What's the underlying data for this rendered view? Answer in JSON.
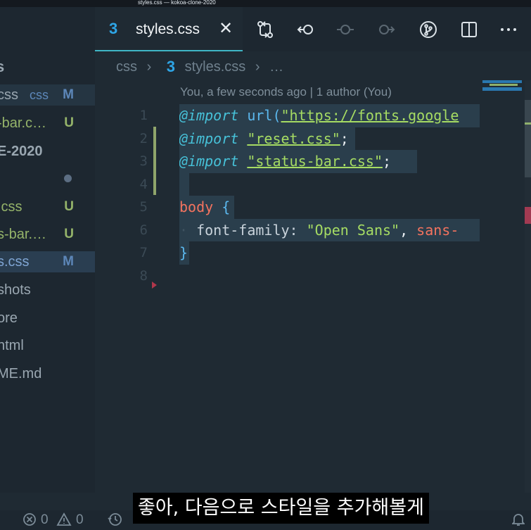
{
  "window": {
    "title": "styles.css — kokoa-clone-2020"
  },
  "sidebar": {
    "header": "s",
    "items": [
      {
        "name": "css",
        "dir": "css",
        "status": "M"
      },
      {
        "name": "-bar.c…",
        "status": "U"
      },
      {
        "name": "E-2020"
      },
      {
        "name": ""
      },
      {
        "name": ".css",
        "status": "U"
      },
      {
        "name": "s-bar.…",
        "status": "U"
      },
      {
        "name": "s.css",
        "status": "M"
      },
      {
        "name": "shots"
      },
      {
        "name": "ore"
      },
      {
        "name": "html"
      },
      {
        "name": "ME.md"
      }
    ]
  },
  "tabbar": {
    "active_tab": {
      "icon": "3",
      "label": "styles.css",
      "close": "✕"
    },
    "icons": [
      "git-compare-icon",
      "go-back-icon",
      "go-commit-icon",
      "go-forward-icon",
      "source-control-icon",
      "split-editor-icon",
      "more-icon"
    ]
  },
  "breadcrumb": {
    "folder": "css",
    "file": "styles.css",
    "rest": "…"
  },
  "editor": {
    "blame": "You, a few seconds ago | 1 author (You)",
    "line_numbers": [
      "1",
      "2",
      "3",
      "4",
      "5",
      "6",
      "7",
      "8"
    ],
    "lines": [
      {
        "a": "@import",
        "b": " url(",
        "c": "\"https://fonts.google"
      },
      {
        "a": "@import",
        "b": " ",
        "c": "\"reset.css\"",
        "d": ";"
      },
      {
        "a": "@import",
        "b": " ",
        "c": "\"status-bar.css\"",
        "d": ";"
      },
      {
        "a": ""
      },
      {
        "a": "body",
        "b": " {"
      },
      {
        "a": "·",
        "b": " font-family: ",
        "c": "\"Open Sans\"",
        "d": ", ",
        "e": "sans-"
      },
      {
        "a": "}"
      },
      {
        "a": ""
      }
    ]
  },
  "statusbar": {
    "errors": "0",
    "warnings": "0"
  },
  "subtitle": "좋아, 다음으로 스타일을 추가해볼게",
  "colors": {
    "accent": "#3fb6c6",
    "css_icon": "#2ea5e6",
    "string": "#a6dc63",
    "keyword": "#47c2d9",
    "selector": "#f3735f"
  }
}
